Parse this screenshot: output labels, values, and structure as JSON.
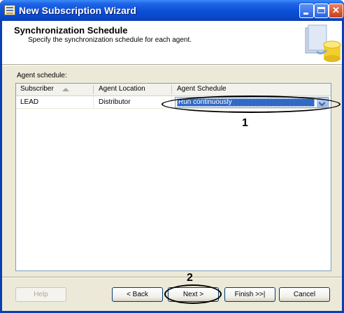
{
  "window": {
    "title": "New Subscription Wizard"
  },
  "header": {
    "title": "Synchronization Schedule",
    "subtitle": "Specify the synchronization schedule for each agent."
  },
  "agent_schedule": {
    "label": "Agent schedule:",
    "columns": [
      "Subscriber",
      "Agent Location",
      "Agent Schedule"
    ],
    "rows": [
      {
        "subscriber": "LEAD",
        "location": "Distributor",
        "schedule": "Run continuously"
      }
    ]
  },
  "callouts": {
    "one": "1",
    "two": "2"
  },
  "buttons": {
    "help": "Help",
    "back": "< Back",
    "next": "Next >",
    "finish": "Finish >>|",
    "cancel": "Cancel"
  },
  "colors": {
    "titlebar": "#0b4fd8",
    "selection": "#316ac5",
    "dialog_bg": "#ece9d8"
  },
  "icons": {
    "title": "wizard-app-icon",
    "header": "database-wizard-icon",
    "dropdown": "chevron-down-icon"
  }
}
